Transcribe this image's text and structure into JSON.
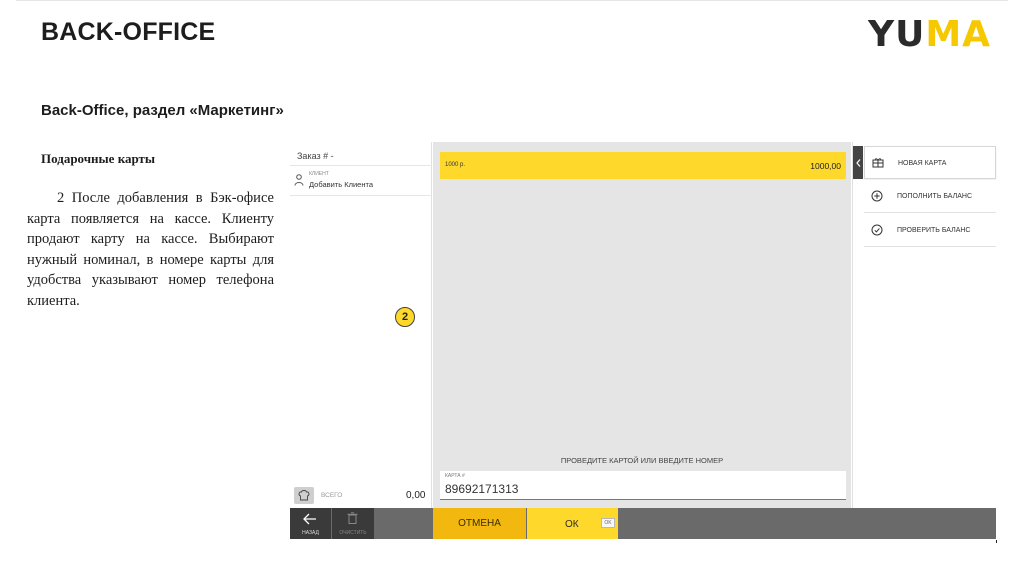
{
  "slide": {
    "title": "BACK-OFFICE",
    "logo_part1": "YU",
    "logo_part2": "MA",
    "section_heading": "Back-Office, раздел «Маркетинг»",
    "subheading": "Подарочные карты",
    "body": "2 После добавления в Бэк-офисе карта появляется на кассе. Клиенту продают карту на кассе. Выбирают нужный номинал, в номере карты для удобства указывают номер телефона клиента.",
    "step_marker": "2"
  },
  "colors": {
    "accent_yellow": "#fed82a",
    "cancel_orange": "#f3b810",
    "dark_bar": "#3a3a3a"
  },
  "pos": {
    "order": {
      "title": "Заказ # -",
      "client_caption": "КЛИЕНТ",
      "client_add": "Добавить Клиента",
      "client_icon": "person-icon",
      "total_icon": "chef-hat-icon",
      "total_label": "ВСЕГО",
      "total_value": "0,00"
    },
    "gift_cards": [
      {
        "name": "1000 р.",
        "amount": "1000,00"
      }
    ],
    "swipe_prompt": "ПРОВЕДИТЕ КАРТОЙ ИЛИ ВВЕДИТЕ НОМЕР",
    "card_input": {
      "caption": "КАРТА #",
      "value": "89692171313"
    },
    "menu": [
      {
        "label": "НОВАЯ КАРТА",
        "icon": "gift-card-icon"
      },
      {
        "label": "ПОПОЛНИТЬ БАЛАНС",
        "icon": "plus-circle-icon"
      },
      {
        "label": "ПРОВЕРИТЬ БАЛАНС",
        "icon": "check-balance-icon"
      }
    ],
    "bottom": {
      "back_label": "НАЗАД",
      "clear_label": "ОЧИСТИТЬ",
      "cancel_label": "ОТМЕНА",
      "ok_label": "ОК",
      "ok_key": "OK"
    }
  }
}
